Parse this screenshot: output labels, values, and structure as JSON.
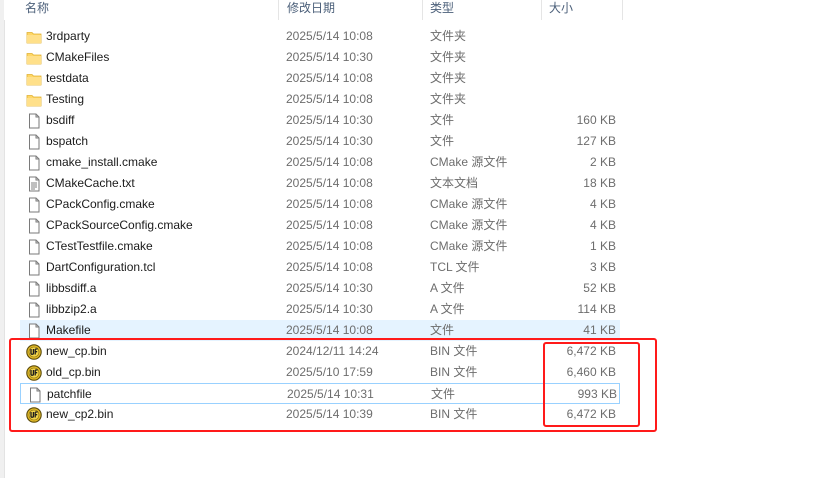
{
  "header": {
    "name": "名称",
    "date": "修改日期",
    "type": "类型",
    "size": "大小"
  },
  "rows": [
    {
      "name": "3rdparty",
      "date": "2025/5/14 10:08",
      "type": "文件夹",
      "size": "",
      "icon": "folder-icon"
    },
    {
      "name": "CMakeFiles",
      "date": "2025/5/14 10:30",
      "type": "文件夹",
      "size": "",
      "icon": "folder-icon"
    },
    {
      "name": "testdata",
      "date": "2025/5/14 10:08",
      "type": "文件夹",
      "size": "",
      "icon": "folder-icon"
    },
    {
      "name": "Testing",
      "date": "2025/5/14 10:08",
      "type": "文件夹",
      "size": "",
      "icon": "folder-icon"
    },
    {
      "name": "bsdiff",
      "date": "2025/5/14 10:30",
      "type": "文件",
      "size": "160 KB",
      "icon": "file-icon"
    },
    {
      "name": "bspatch",
      "date": "2025/5/14 10:30",
      "type": "文件",
      "size": "127 KB",
      "icon": "file-icon"
    },
    {
      "name": "cmake_install.cmake",
      "date": "2025/5/14 10:08",
      "type": "CMake 源文件",
      "size": "2 KB",
      "icon": "file-icon"
    },
    {
      "name": "CMakeCache.txt",
      "date": "2025/5/14 10:08",
      "type": "文本文档",
      "size": "18 KB",
      "icon": "text-file-icon"
    },
    {
      "name": "CPackConfig.cmake",
      "date": "2025/5/14 10:08",
      "type": "CMake 源文件",
      "size": "4 KB",
      "icon": "file-icon"
    },
    {
      "name": "CPackSourceConfig.cmake",
      "date": "2025/5/14 10:08",
      "type": "CMake 源文件",
      "size": "4 KB",
      "icon": "file-icon"
    },
    {
      "name": "CTestTestfile.cmake",
      "date": "2025/5/14 10:08",
      "type": "CMake 源文件",
      "size": "1 KB",
      "icon": "file-icon"
    },
    {
      "name": "DartConfiguration.tcl",
      "date": "2025/5/14 10:08",
      "type": "TCL 文件",
      "size": "3 KB",
      "icon": "file-icon"
    },
    {
      "name": "libbsdiff.a",
      "date": "2025/5/14 10:30",
      "type": "A 文件",
      "size": "52 KB",
      "icon": "file-icon"
    },
    {
      "name": "libbzip2.a",
      "date": "2025/5/14 10:30",
      "type": "A 文件",
      "size": "114 KB",
      "icon": "file-icon"
    },
    {
      "name": "Makefile",
      "date": "2025/5/14 10:08",
      "type": "文件",
      "size": "41 KB",
      "icon": "file-icon",
      "state": "hover"
    },
    {
      "name": "new_cp.bin",
      "date": "2024/12/11 14:24",
      "type": "BIN 文件",
      "size": "6,472 KB",
      "icon": "bin-file-icon"
    },
    {
      "name": "old_cp.bin",
      "date": "2025/5/10 17:59",
      "type": "BIN 文件",
      "size": "6,460 KB",
      "icon": "bin-file-icon"
    },
    {
      "name": "patchfile",
      "date": "2025/5/14 10:31",
      "type": "文件",
      "size": "993 KB",
      "icon": "file-icon",
      "state": "focused"
    },
    {
      "name": "new_cp2.bin",
      "date": "2025/5/14 10:39",
      "type": "BIN 文件",
      "size": "6,472 KB",
      "icon": "bin-file-icon"
    }
  ],
  "colors": {
    "highlight_box": "#ff1a1a",
    "hover_row": "#e5f3ff",
    "folder": "#ffd766",
    "header_text": "#4c607a"
  }
}
